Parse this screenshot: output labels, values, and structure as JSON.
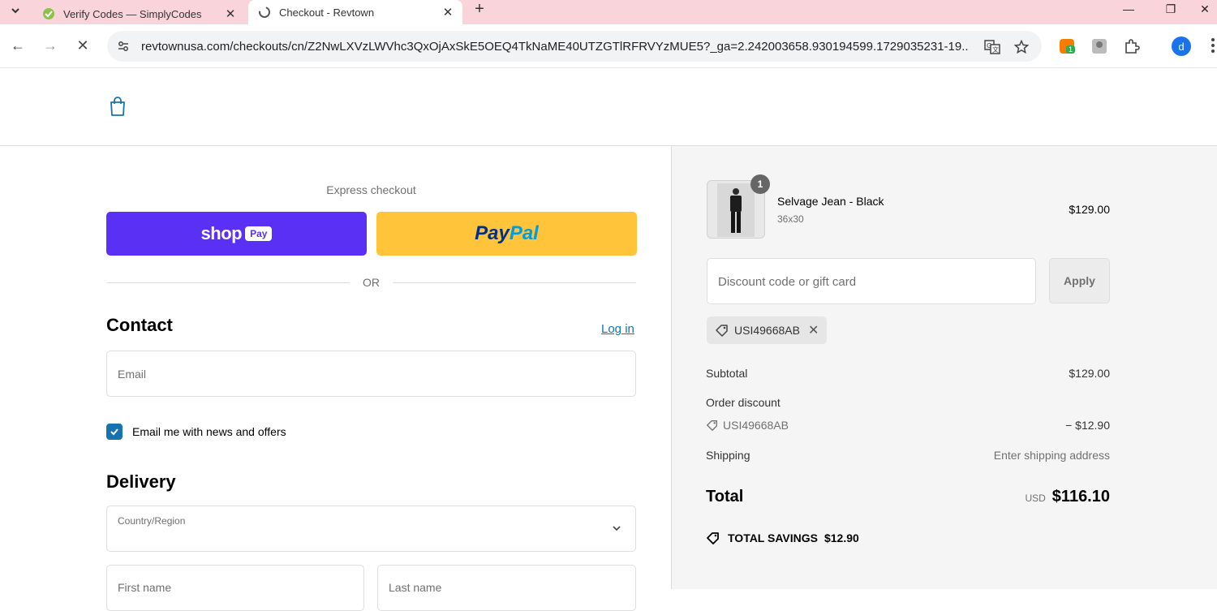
{
  "browser": {
    "tabs": [
      {
        "title": "Verify Codes — SimplyCodes",
        "active": false
      },
      {
        "title": "Checkout - Revtown",
        "active": true
      }
    ],
    "url": "revtownusa.com/checkouts/cn/Z2NwLXVzLWVhc3QxOjAxSkE5OEQ4TkNaME40UTZGTlRFRVYzMUE5?_ga=2.242003658.930194599.1729035231-19...",
    "extension_badge": "1",
    "profile_initial": "d"
  },
  "checkout": {
    "express_label": "Express checkout",
    "shoppay_label": "shop",
    "shoppay_pill": "Pay",
    "paypal_part1": "Pay",
    "paypal_part2": "Pal",
    "or_label": "OR",
    "contact": {
      "title": "Contact",
      "login_label": "Log in",
      "email_placeholder": "Email",
      "newsletter_label": "Email me with news and offers",
      "newsletter_checked": true
    },
    "delivery": {
      "title": "Delivery",
      "country_label": "Country/Region",
      "first_name_placeholder": "First name",
      "last_name_placeholder": "Last name"
    }
  },
  "summary": {
    "product": {
      "name": "Selvage Jean - Black",
      "variant": "36x30",
      "price": "$129.00",
      "quantity": "1"
    },
    "discount_placeholder": "Discount code or gift card",
    "apply_label": "Apply",
    "applied_code": "USI49668AB",
    "subtotal_label": "Subtotal",
    "subtotal_value": "$129.00",
    "order_discount_label": "Order discount",
    "order_discount_code": "USI49668AB",
    "order_discount_value": "− $12.90",
    "shipping_label": "Shipping",
    "shipping_value": "Enter shipping address",
    "total_label": "Total",
    "total_currency": "USD",
    "total_value": "$116.10",
    "savings_label": "TOTAL SAVINGS",
    "savings_value": "$12.90"
  },
  "colors": {
    "shoppay": "#5a31f4",
    "paypal": "#ffc439",
    "link": "#1773b0",
    "tabbar": "#f9d5db"
  }
}
